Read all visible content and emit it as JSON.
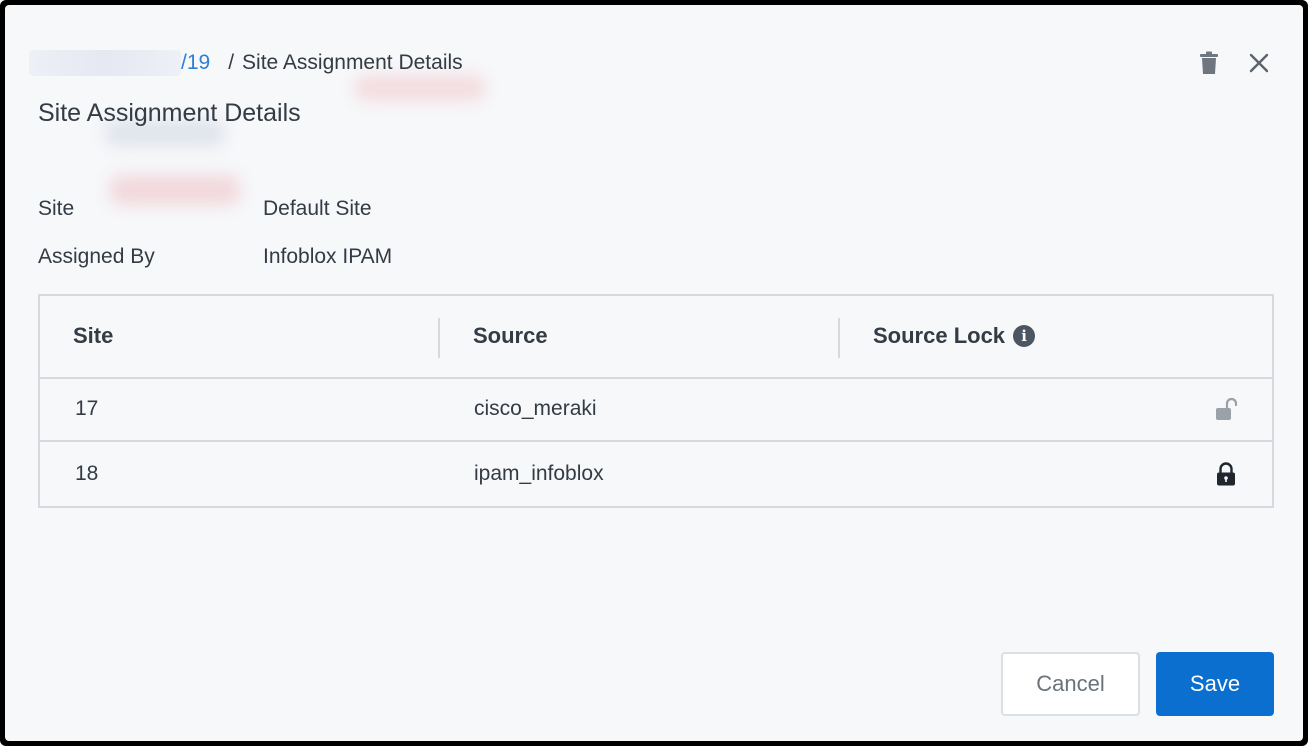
{
  "breadcrumb": {
    "parent_link": "/19",
    "separator": "/",
    "current": "Site Assignment Details"
  },
  "header_icons": [
    "trash-icon",
    "close-icon"
  ],
  "title": "Site Assignment Details",
  "details": [
    {
      "label": "Site",
      "value": "Default Site"
    },
    {
      "label": "Assigned By",
      "value": "Infoblox IPAM"
    }
  ],
  "table": {
    "columns": [
      "Site",
      "Source",
      "Source Lock"
    ],
    "rows": [
      {
        "site": "17",
        "source": "cisco_meraki",
        "lock": "unlocked"
      },
      {
        "site": "18",
        "source": "ipam_infoblox",
        "lock": "locked"
      }
    ]
  },
  "buttons": {
    "cancel": "Cancel",
    "save": "Save"
  },
  "colors": {
    "link": "#2d7fd6",
    "primary": "#0b6fd0",
    "text": "#333b44",
    "border": "#d6d9de"
  }
}
